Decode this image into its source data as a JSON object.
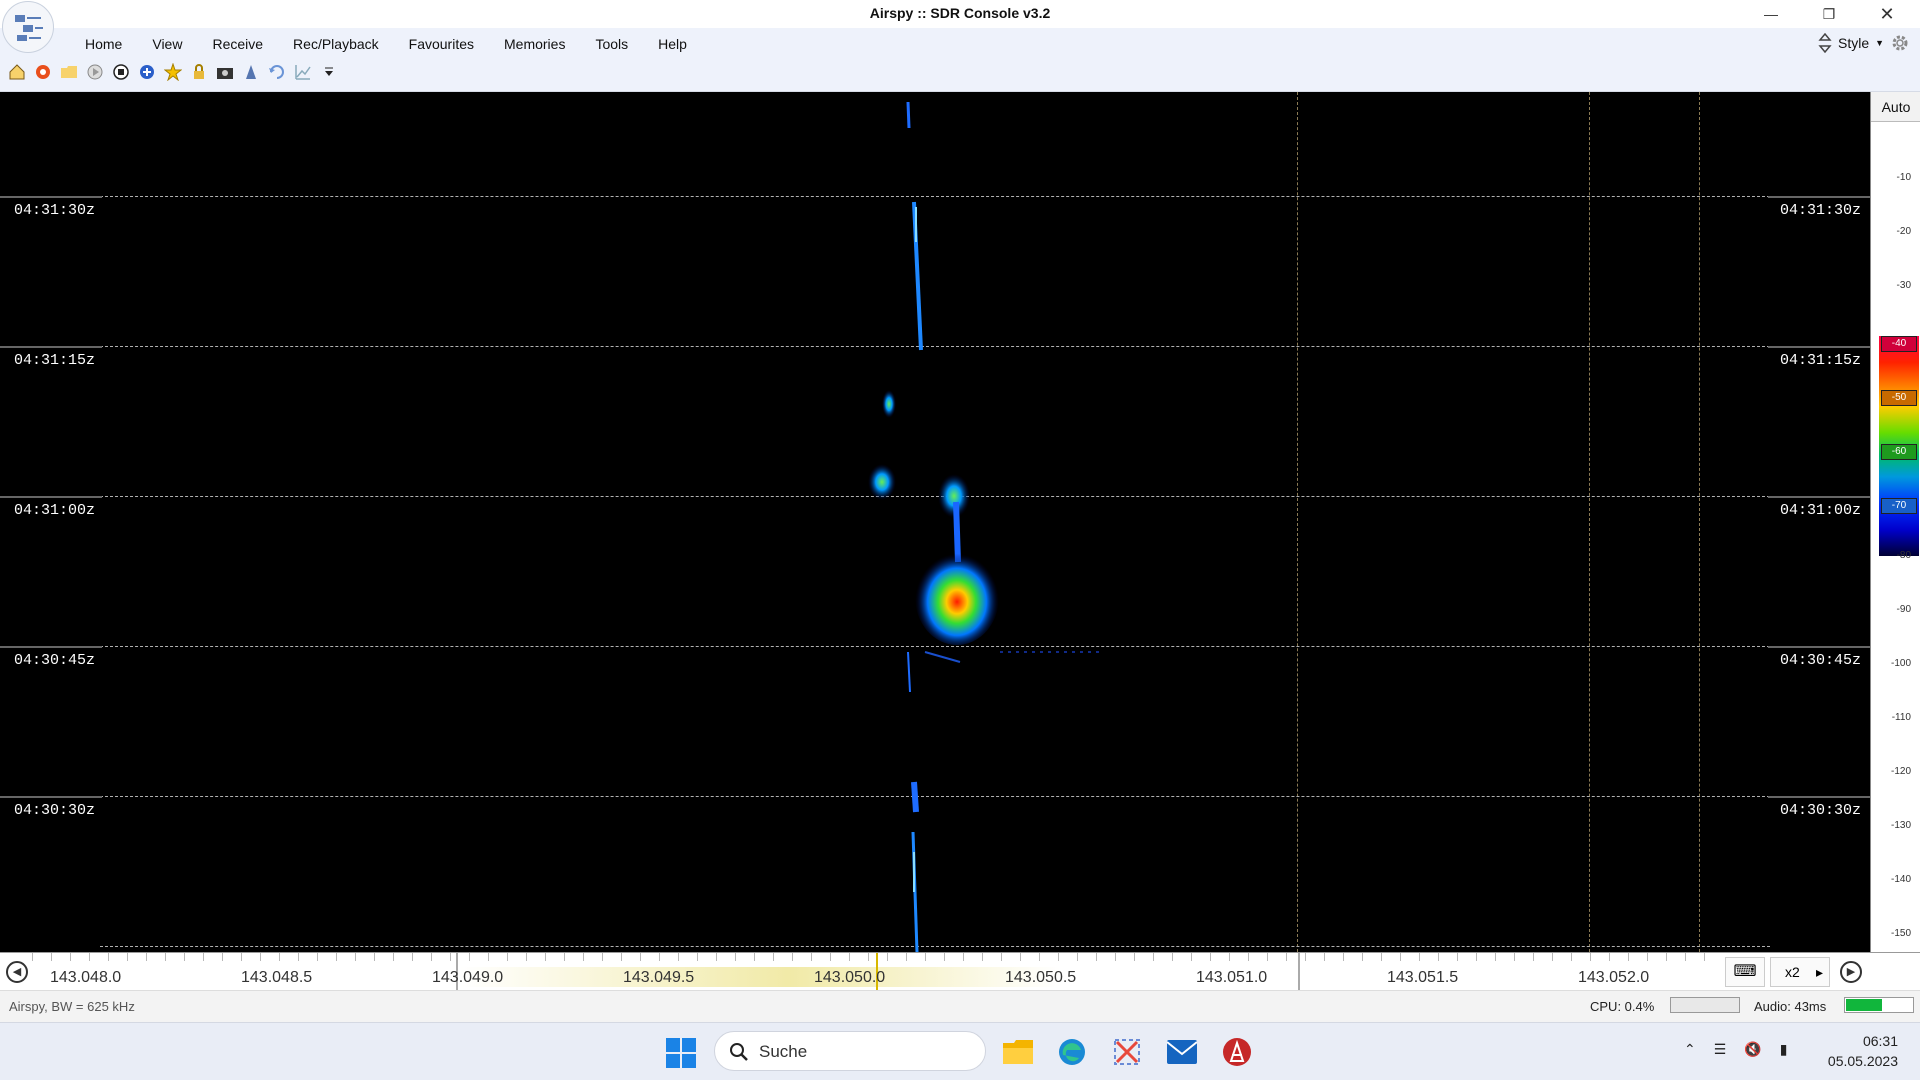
{
  "window": {
    "title": "Airspy :: SDR Console v3.2"
  },
  "menu": [
    "Home",
    "View",
    "Receive",
    "Rec/Playback",
    "Favourites",
    "Memories",
    "Tools",
    "Help"
  ],
  "style_label": "Style",
  "toolbar_icons": [
    "home-icon",
    "lifebuoy-icon",
    "folder-icon",
    "play-icon",
    "stop-icon",
    "add-icon",
    "star-icon",
    "lock-icon",
    "camera-icon",
    "beacon-icon",
    "undo-icon",
    "chart-icon",
    "dropdown-arrow-icon"
  ],
  "waterfall": {
    "time_labels": [
      "04:31:30z",
      "04:31:15z",
      "04:31:00z",
      "04:30:45z",
      "04:30:30z"
    ]
  },
  "scale": {
    "auto_label": "Auto",
    "db_labels": [
      "-10",
      "-20",
      "-30",
      "-40",
      "-50",
      "-60",
      "-70",
      "-80",
      "-90",
      "-100",
      "-110",
      "-120",
      "-130",
      "-140",
      "-150"
    ],
    "colorbar_marks": [
      "-40",
      "-50",
      "-60",
      "-70"
    ]
  },
  "freqbar": {
    "labels": [
      "143.048.0",
      "143.048.5",
      "143.049.0",
      "143.049.5",
      "143.050.0",
      "143.050.5",
      "143.051.0",
      "143.051.5",
      "143.052.0"
    ],
    "zoom": "x2"
  },
  "status": {
    "left": "Airspy, BW = 625 kHz",
    "cpu": "CPU: 0.4%",
    "audio": "Audio: 43ms",
    "audio_level": 0.55
  },
  "taskbar": {
    "search_placeholder": "Suche",
    "time": "06:31",
    "date": "05.05.2023"
  },
  "colors": {
    "ribbon": "#eef2fb",
    "waterfall_bg": "#000000",
    "audio_meter": "#11b63c"
  }
}
